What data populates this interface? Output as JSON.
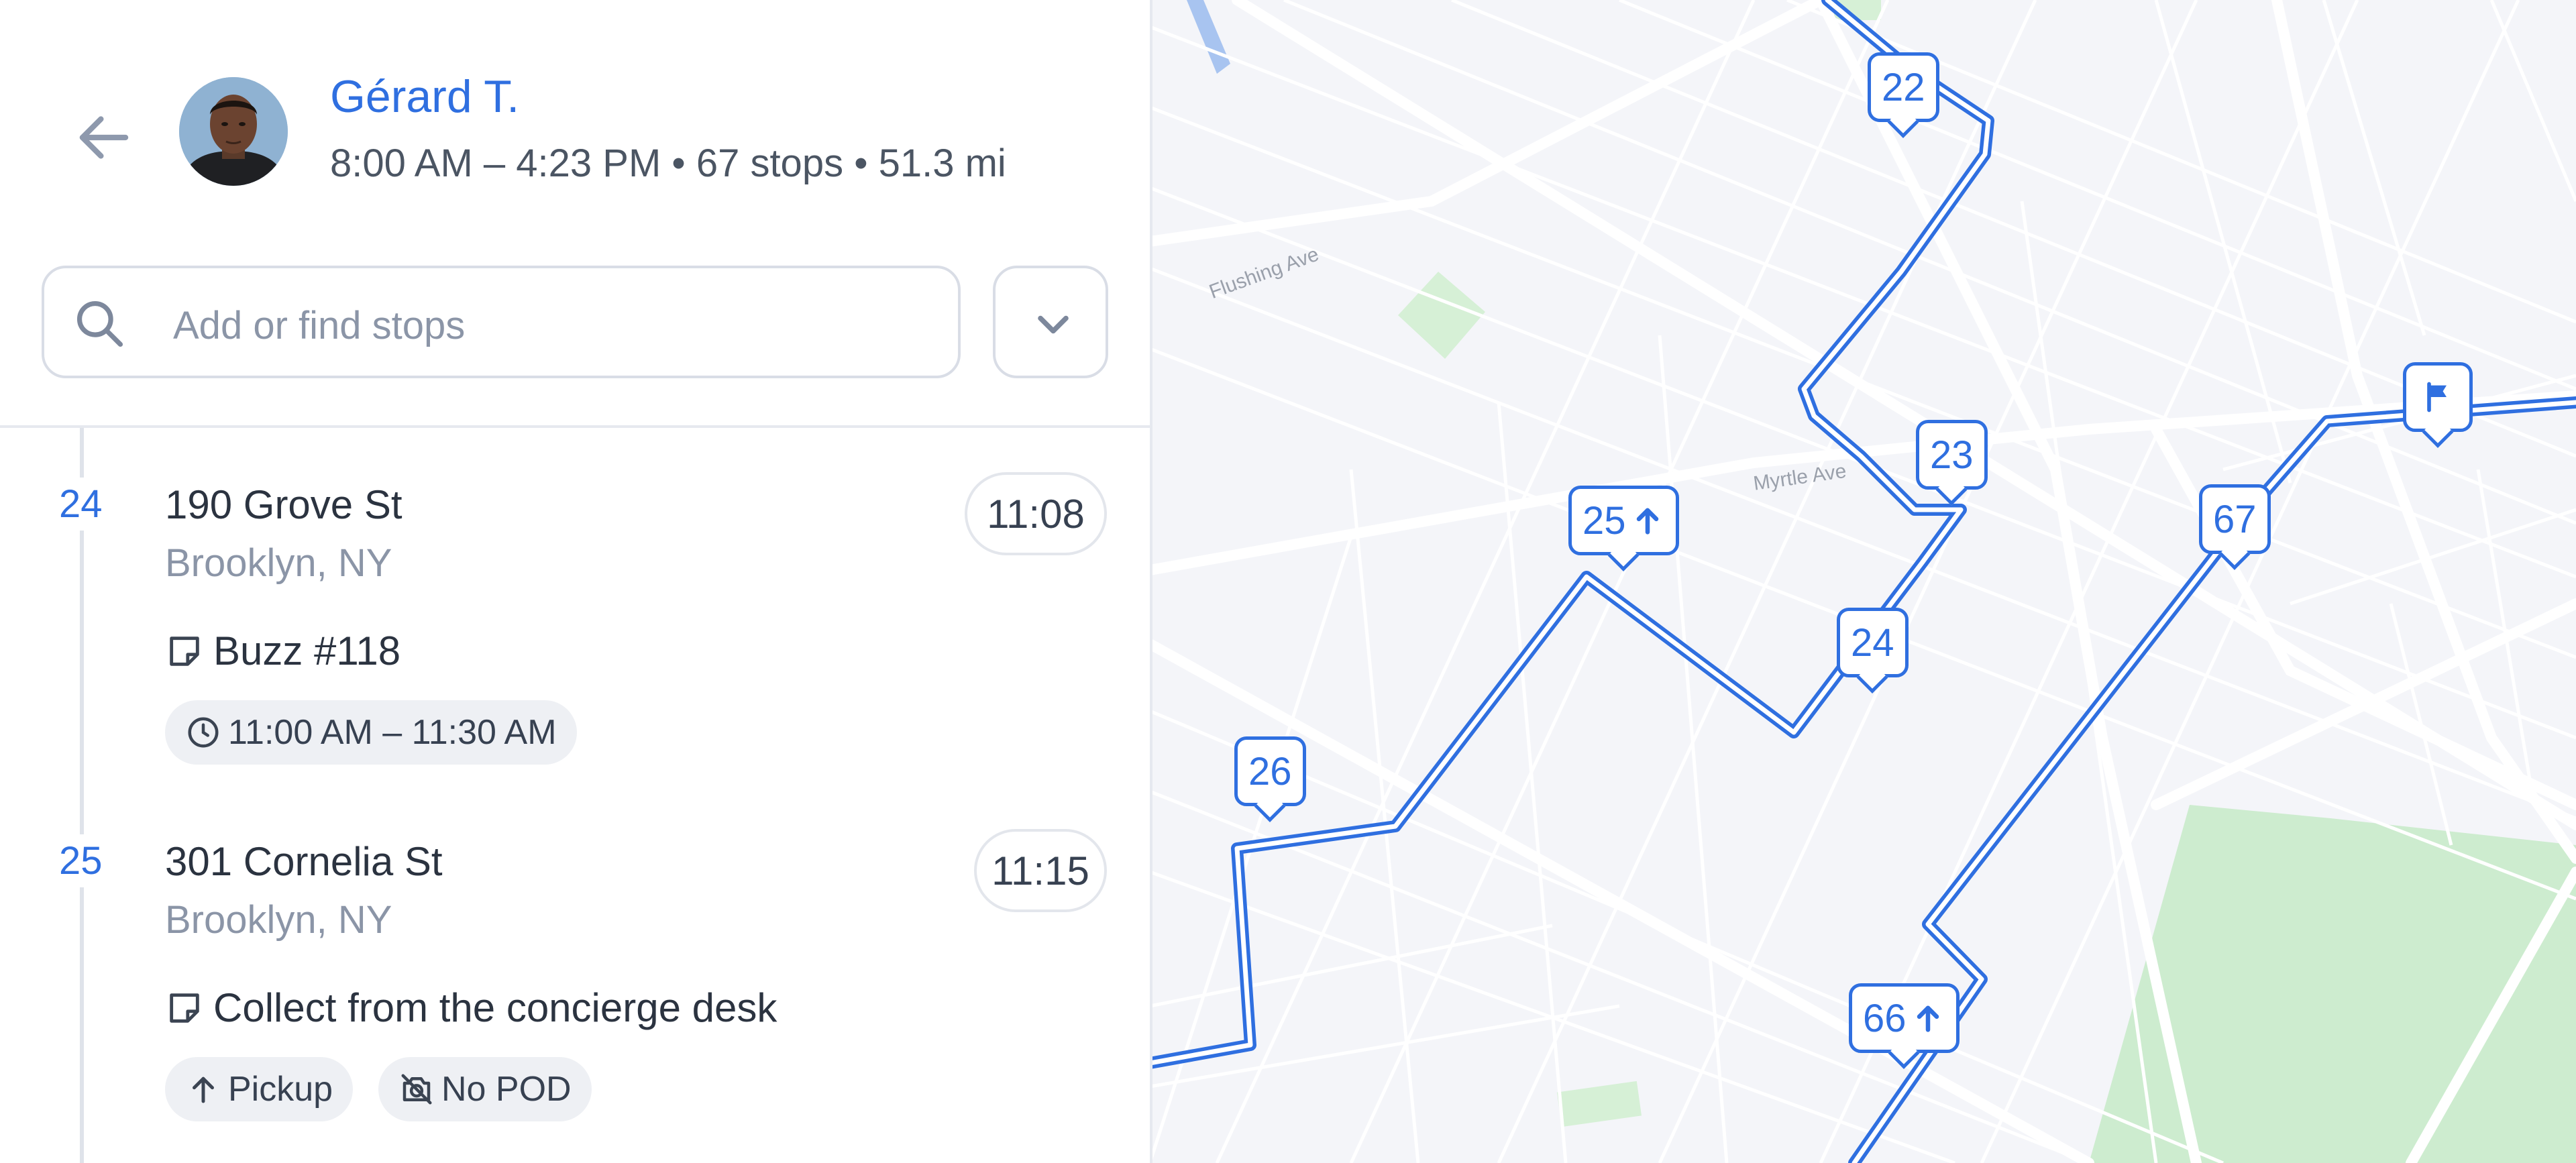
{
  "header": {
    "driver_name": "Gérard T.",
    "route_summary": "8:00 AM – 4:23 PM • 67 stops • 51.3 mi"
  },
  "search": {
    "placeholder": "Add or find stops",
    "value": ""
  },
  "stops": [
    {
      "number": "24",
      "address": "190 Grove St",
      "city": "Brooklyn, NY",
      "eta": "11:08",
      "note": "Buzz #118",
      "chips": [
        {
          "icon": "clock-icon",
          "label": "11:00 AM – 11:30 AM"
        }
      ]
    },
    {
      "number": "25",
      "address": "301 Cornelia St",
      "city": "Brooklyn, NY",
      "eta": "11:15",
      "note": "Collect from the concierge desk",
      "chips": [
        {
          "icon": "arrow-up-icon",
          "label": "Pickup"
        },
        {
          "icon": "camera-off-icon",
          "label": "No POD"
        }
      ]
    }
  ],
  "map": {
    "street_labels": [
      "Flushing Ave",
      "Myrtle Ave"
    ],
    "pins": [
      {
        "label": "22",
        "pickup": false
      },
      {
        "label": "23",
        "pickup": false
      },
      {
        "label": "25",
        "pickup": true
      },
      {
        "label": "24",
        "pickup": false
      },
      {
        "label": "26",
        "pickup": false
      },
      {
        "label": "67",
        "pickup": false
      },
      {
        "label": "66",
        "pickup": true
      },
      {
        "label": "",
        "icon": "flag-icon"
      }
    ]
  },
  "colors": {
    "accent": "#2f6fe0",
    "park": "#cdeccf",
    "map_bg": "#f4f5f9",
    "muted": "#8b95a7"
  }
}
